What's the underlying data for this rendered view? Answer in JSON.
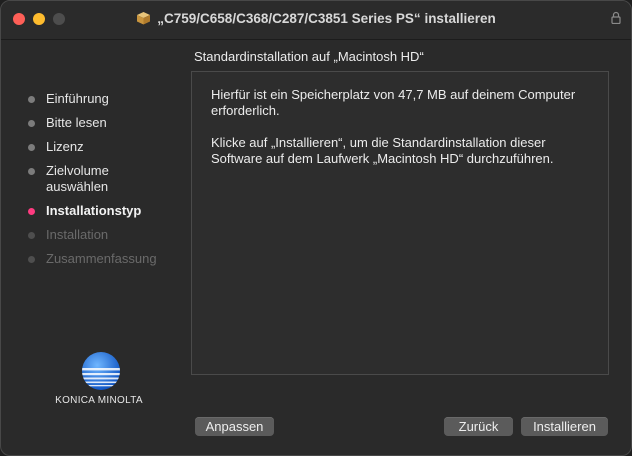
{
  "window": {
    "title": "„C759/C658/C368/C287/C3851 Series PS“ installieren"
  },
  "heading": "Standardinstallation auf „Macintosh HD“",
  "sidebar": {
    "steps": [
      {
        "label": "Einführung",
        "state": "done"
      },
      {
        "label": "Bitte lesen",
        "state": "done"
      },
      {
        "label": "Lizenz",
        "state": "done"
      },
      {
        "label": "Zielvolume\nauswählen",
        "state": "done"
      },
      {
        "label": "Installationstyp",
        "state": "current"
      },
      {
        "label": "Installation",
        "state": "future"
      },
      {
        "label": "Zusammenfassung",
        "state": "future"
      }
    ]
  },
  "logo": {
    "text": "KONICA MINOLTA"
  },
  "content": {
    "paragraph1": "Hierfür ist ein Speicherplatz von 47,7 MB auf deinem Computer erforderlich.",
    "paragraph2": "Klicke auf „Installieren“, um die Standardinstallation dieser Software auf dem Laufwerk „Macintosh HD“ durchzuführen."
  },
  "buttons": {
    "customize": "Anpassen",
    "back": "Zurück",
    "install": "Installieren"
  },
  "colors": {
    "current_step": "#ff3b80",
    "window_bg": "#2a2a2a"
  },
  "icons": {
    "title": "package-icon",
    "lock": "lock-icon"
  }
}
